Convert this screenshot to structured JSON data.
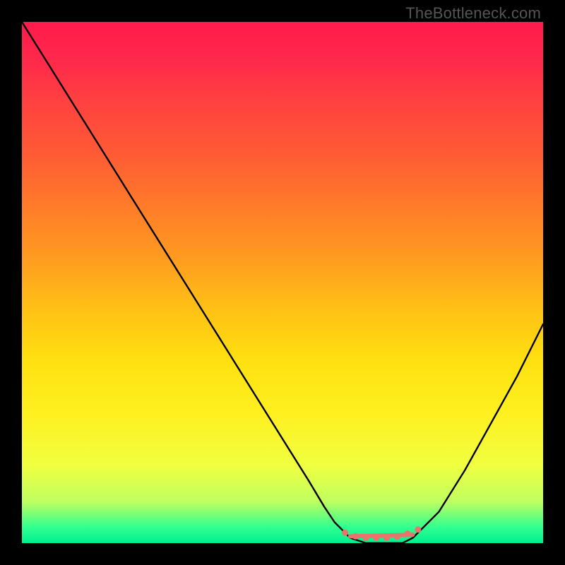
{
  "watermark": "TheBottleneck.com",
  "chart_data": {
    "type": "line",
    "title": "",
    "xlabel": "",
    "ylabel": "",
    "xlim": [
      0,
      100
    ],
    "ylim": [
      0,
      100
    ],
    "series": [
      {
        "name": "curve",
        "x": [
          0,
          5,
          10,
          15,
          20,
          25,
          30,
          35,
          40,
          45,
          50,
          55,
          58,
          60,
          63,
          66,
          70,
          73,
          75,
          80,
          85,
          90,
          95,
          100
        ],
        "y": [
          100,
          92,
          84,
          76,
          68,
          60,
          52,
          44,
          36,
          28,
          20,
          12,
          7,
          4,
          1,
          0,
          0,
          0,
          1,
          6,
          14,
          23,
          32,
          42
        ]
      }
    ],
    "markers": {
      "name": "emphasis-dots",
      "color": "#e8746c",
      "x": [
        62,
        64,
        66,
        68,
        70,
        72,
        74,
        76
      ],
      "y": [
        2,
        1.3,
        1,
        1,
        1,
        1.2,
        1.8,
        2.6
      ]
    },
    "underline": {
      "name": "emphasis-line",
      "color": "#e8746c",
      "x": [
        63,
        75
      ],
      "y": [
        1.3,
        1.6
      ]
    },
    "background_gradient": {
      "top_color": "#ff1a4d",
      "bottom_color": "#00f090"
    }
  }
}
